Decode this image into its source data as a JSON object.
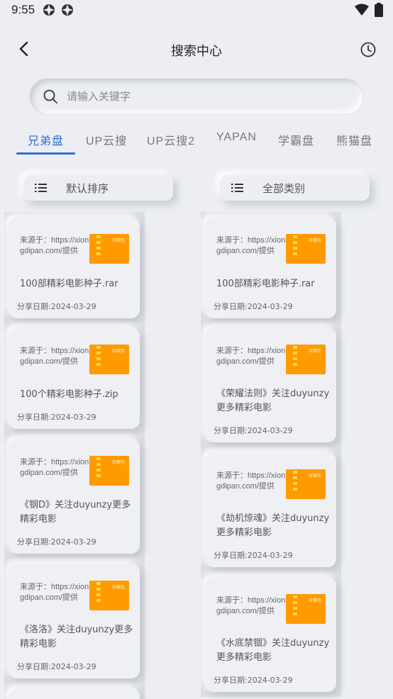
{
  "status": {
    "time": "9:55"
  },
  "header": {
    "title": "搜索中心"
  },
  "search": {
    "placeholder": "请输入关键字"
  },
  "tabs": [
    "兄弟盘",
    "UP云搜",
    "UP云搜2",
    "YAPAN",
    "学霸盘",
    "熊猫盘"
  ],
  "active_tab": "兄弟盘",
  "filters": {
    "sort": "默认排序",
    "category": "全部类别"
  },
  "thumb_label": "压缩包",
  "left_column": [
    {
      "source": "来源于：https://xiongdipan.com/提供",
      "name": "100部精彩电影种子.rar",
      "date": "分享日期:2024-03-29"
    },
    {
      "source": "来源于：https://xiongdipan.com/提供",
      "name": "100个精彩电影种子.zip",
      "date": "分享日期:2024-03-29"
    },
    {
      "source": "来源于：https://xiongdipan.com/提供",
      "name": "《钢D》关注duyunzy更多精彩电影",
      "date": "分享日期:2024-03-29"
    },
    {
      "source": "来源于：https://xiongdipan.com/提供",
      "name": "《洛洛》关注duyunzy更多精彩电影",
      "date": "分享日期:2024-03-29"
    }
  ],
  "right_column": [
    {
      "source": "来源于：https://xiongdipan.com/提供",
      "name": "100部精彩电影种子.rar",
      "date": "分享日期:2024-03-29"
    },
    {
      "source": "来源于：https://xiongdipan.com/提供",
      "name": "《荣耀法则》关注duyunzy更多精彩电影",
      "date": "分享日期:2024-03-29"
    },
    {
      "source": "来源于：https://xiongdipan.com/提供",
      "name": "《劫机惊魂》关注duyunzy更多精彩电影",
      "date": "分享日期:2024-03-29"
    },
    {
      "source": "来源于：https://xiongdipan.com/提供",
      "name": "《水底禁锢》关注duyunzy更多精彩电影",
      "date": "分享日期:2024-03-29"
    }
  ],
  "colors": {
    "accent": "#2f6fd8",
    "thumb": "#ff9a00",
    "background": "#eceef3"
  },
  "icons": [
    "status-app-icon",
    "wifi-icon",
    "battery-icon",
    "back-arrow-icon",
    "clock-history-icon",
    "search-icon",
    "list-icon"
  ]
}
